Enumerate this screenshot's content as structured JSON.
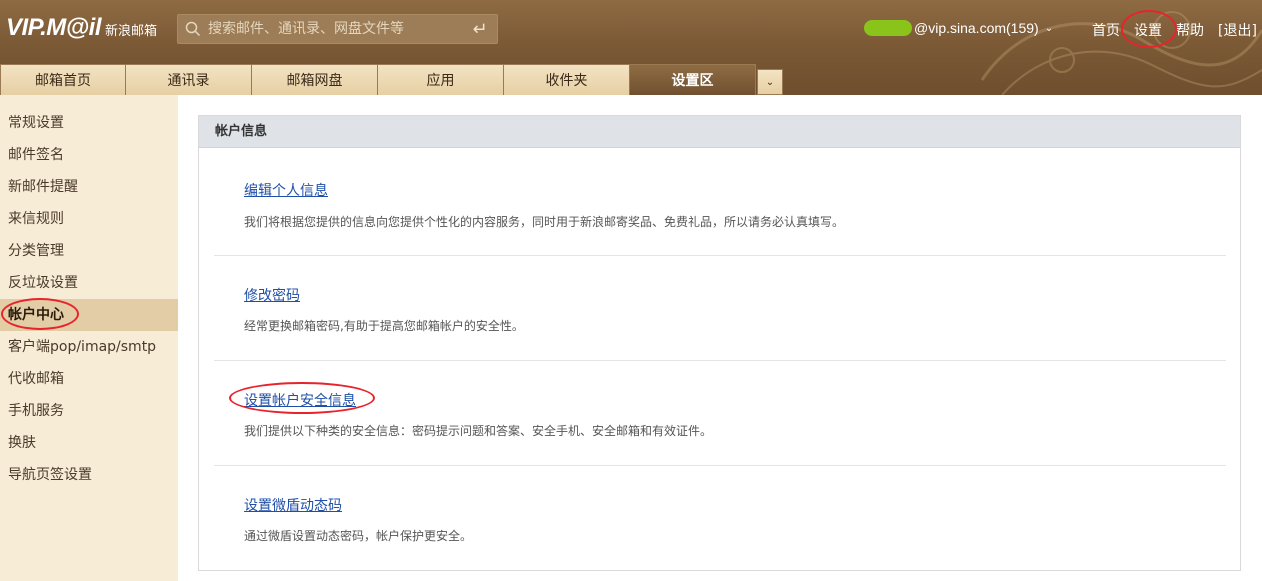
{
  "header": {
    "logo_main": "VIP.M@il",
    "logo_sub": "新浪邮箱",
    "search_placeholder": "搜索邮件、通讯录、网盘文件等",
    "account": "@vip.sina.com(159)",
    "links": [
      "首页",
      "设置",
      "帮助",
      "[退出]"
    ]
  },
  "tabs": [
    {
      "label": "邮箱首页",
      "active": false
    },
    {
      "label": "通讯录",
      "active": false
    },
    {
      "label": "邮箱网盘",
      "active": false
    },
    {
      "label": "应用",
      "active": false
    },
    {
      "label": "收件夹",
      "active": false
    },
    {
      "label": "设置区",
      "active": true
    }
  ],
  "sidebar": {
    "items": [
      {
        "label": "常规设置",
        "active": false
      },
      {
        "label": "邮件签名",
        "active": false
      },
      {
        "label": "新邮件提醒",
        "active": false
      },
      {
        "label": "来信规则",
        "active": false
      },
      {
        "label": "分类管理",
        "active": false
      },
      {
        "label": "反垃圾设置",
        "active": false
      },
      {
        "label": "帐户中心",
        "active": true
      },
      {
        "label": "客户端pop/imap/smtp",
        "active": false
      },
      {
        "label": "代收邮箱",
        "active": false
      },
      {
        "label": "手机服务",
        "active": false
      },
      {
        "label": "换肤",
        "active": false
      },
      {
        "label": "导航页签设置",
        "active": false
      }
    ]
  },
  "panel": {
    "title": "帐户信息",
    "sections": [
      {
        "link": "编辑个人信息",
        "desc": "我们将根据您提供的信息向您提供个性化的内容服务，同时用于新浪邮寄奖品、免费礼品，所以请务必认真填写。"
      },
      {
        "link": "修改密码",
        "desc": "经常更换邮箱密码,有助于提高您邮箱帐户的安全性。"
      },
      {
        "link": "设置帐户安全信息",
        "desc": "我们提供以下种类的安全信息：密码提示问题和答案、安全手机、安全邮箱和有效证件。"
      },
      {
        "link": "设置微盾动态码",
        "desc": "通过微盾设置动态密码，帐户保护更安全。"
      }
    ]
  },
  "colors": {
    "header_brown": "#7c5a36",
    "tab_bg": "#e6cfa3",
    "sidebar_bg": "#f7ecd6",
    "link_blue": "#1f4fa8",
    "annotation_red": "#e8232b",
    "account_mask_green": "#8ac41b"
  }
}
